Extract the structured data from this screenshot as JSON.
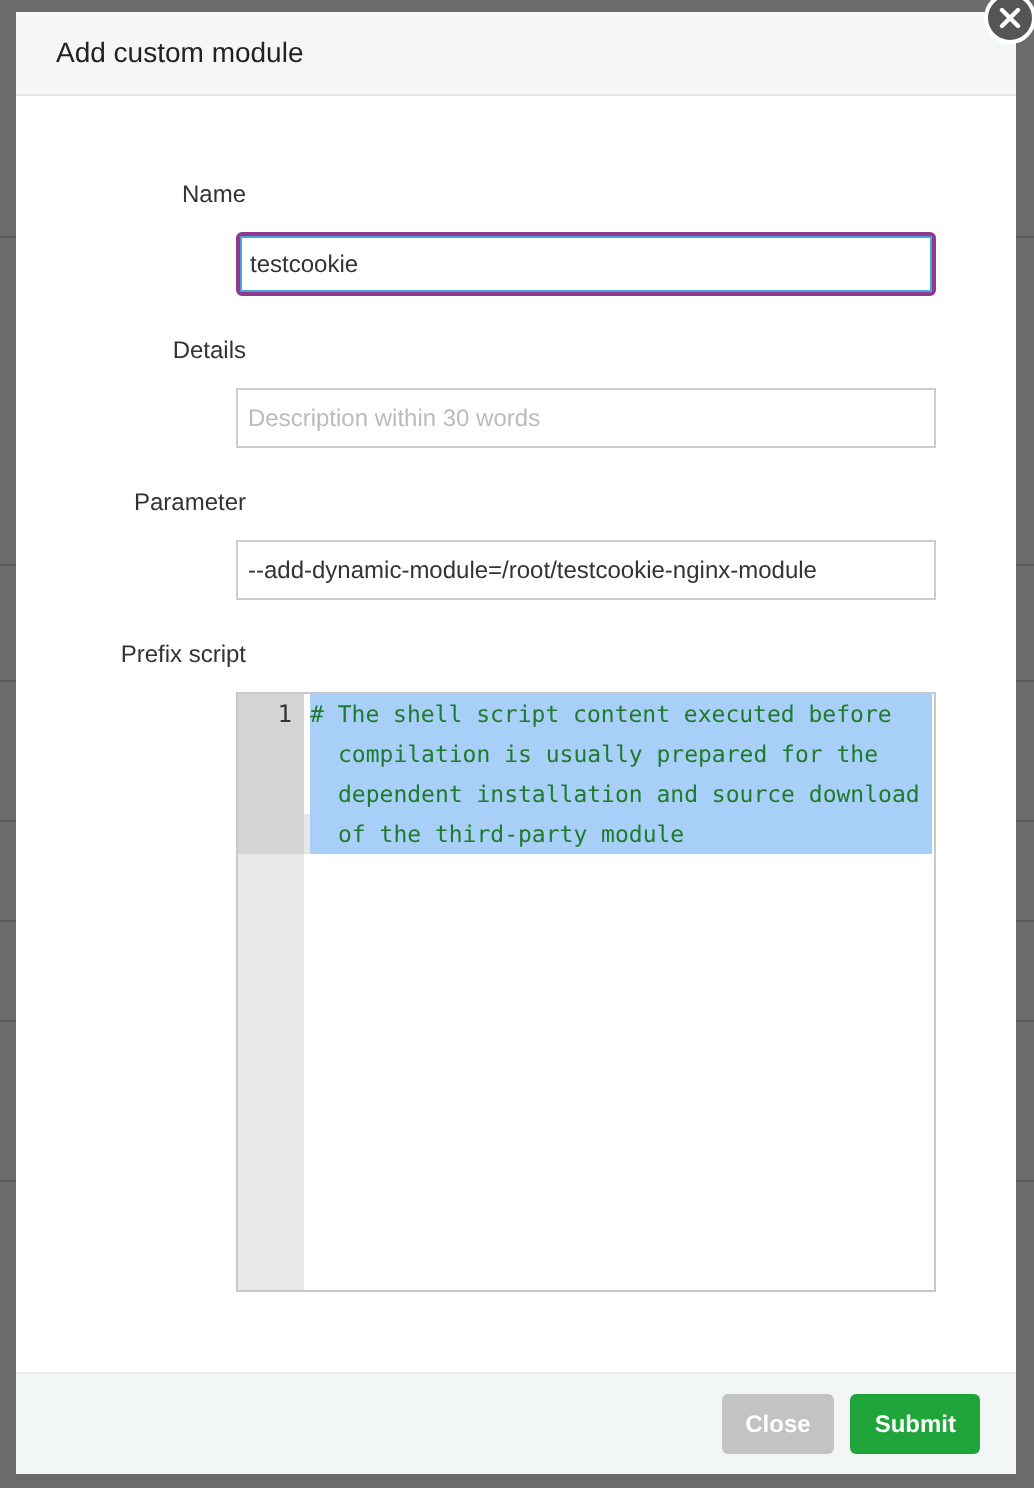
{
  "dialog": {
    "title": "Add custom module",
    "fields": [
      {
        "kind": "input",
        "label": "Name",
        "value": "testcookie",
        "focused": true
      },
      {
        "kind": "input",
        "label": "Details",
        "placeholder": "Description within 30 words",
        "focused": false
      },
      {
        "kind": "input",
        "label": "Parameter",
        "value": "--add-dynamic-module=/root/testcookie-nginx-module",
        "focused": false
      },
      {
        "kind": "code",
        "label": "Prefix script",
        "lines": [
          {
            "number": "1",
            "text": "# The shell script content executed before compilation is usually prepared for the dependent installation and source download of the third-party module",
            "selected": true
          }
        ]
      }
    ],
    "buttons": [
      {
        "label": "Close",
        "kind": "secondary",
        "disabled": true
      },
      {
        "label": "Submit",
        "kind": "primary",
        "disabled": false
      }
    ]
  }
}
